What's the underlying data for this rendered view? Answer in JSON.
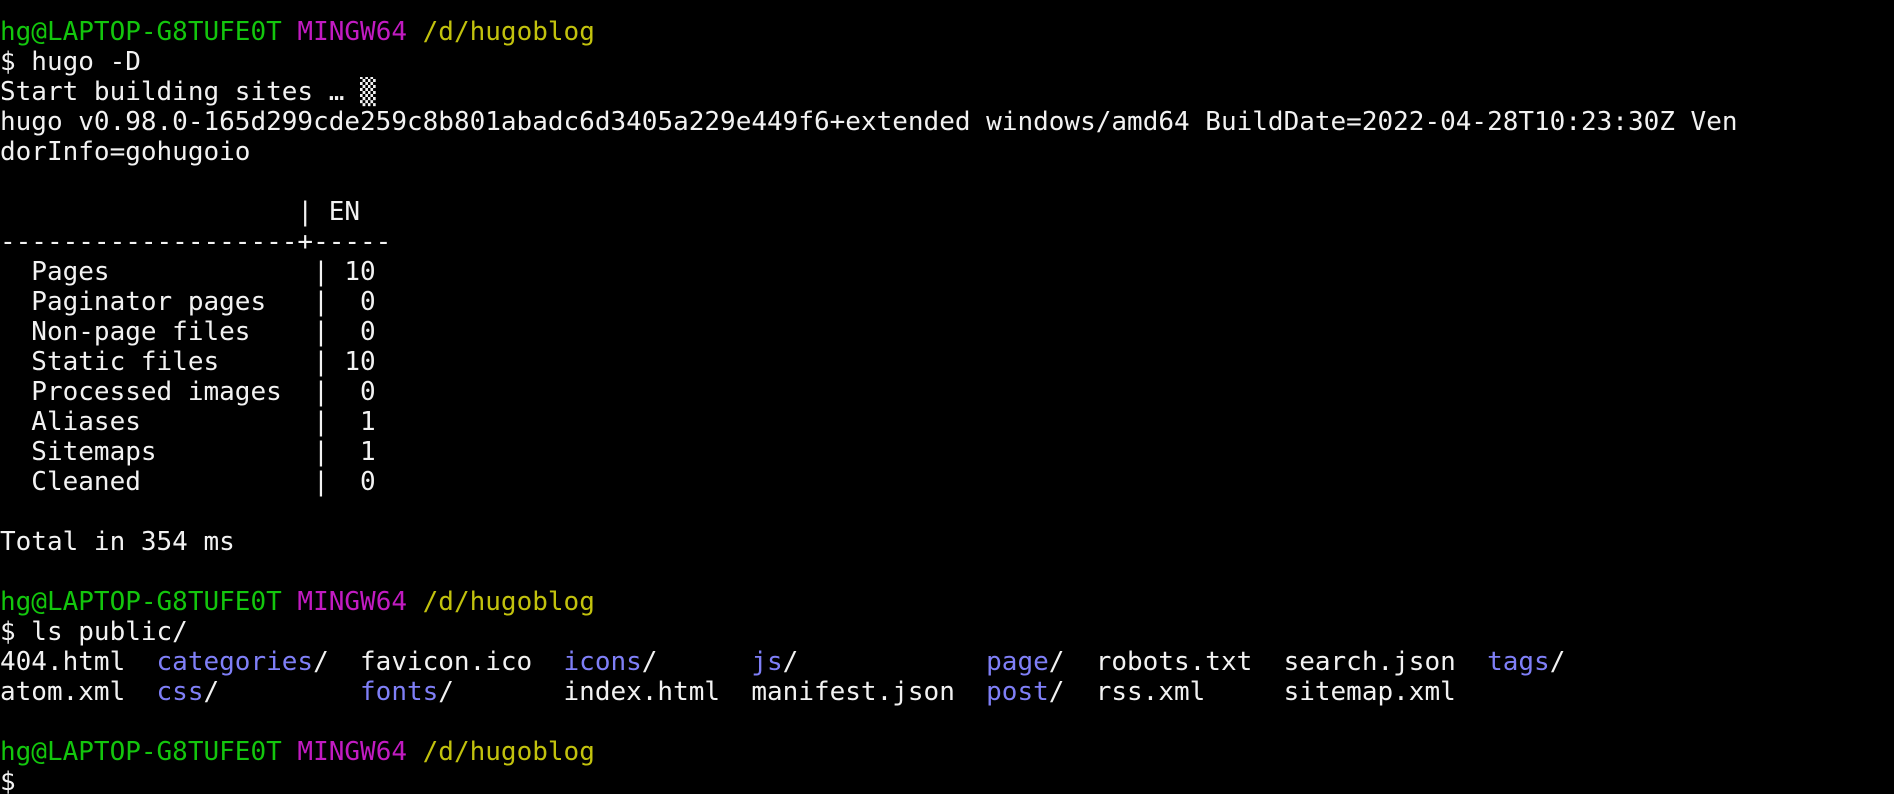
{
  "colors": {
    "background": "#000000",
    "text": "#f2f2f2",
    "user": "#13c60d",
    "env": "#c21bc2",
    "path": "#c2c20d",
    "directory": "#7f7ff7"
  },
  "prompts": [
    {
      "user": "hg@LAPTOP-G8TUFE0T",
      "env": "MINGW64",
      "path": "/d/hugoblog",
      "command": "$ hugo -D"
    },
    {
      "user": "hg@LAPTOP-G8TUFE0T",
      "env": "MINGW64",
      "path": "/d/hugoblog",
      "command": "$ ls public/"
    },
    {
      "user": "hg@LAPTOP-G8TUFE0T",
      "env": "MINGW64",
      "path": "/d/hugoblog",
      "command": "$"
    }
  ],
  "build": {
    "start": "Start building sites … ",
    "version_line_1": "hugo v0.98.0-165d299cde259c8b801abadc6d3405a229e449f6+extended windows/amd64 BuildDate=2022-04-28T10:23:30Z Ven",
    "version_line_2": "dorInfo=gohugoio",
    "table_header": "                   | EN",
    "table_divider": "-------------------+-----",
    "stats": [
      "  Pages             | 10",
      "  Paginator pages   |  0",
      "  Non-page files    |  0",
      "  Static files      | 10",
      "  Processed images  |  0",
      "  Aliases           |  1",
      "  Sitemaps          |  1",
      "  Cleaned           |  0"
    ],
    "total": "Total in 354 ms"
  },
  "listing": {
    "row1": [
      {
        "name": "404.html",
        "suffix": "",
        "is_dir": false
      },
      {
        "name": "categories",
        "suffix": "/",
        "is_dir": true
      },
      {
        "name": "favicon.ico",
        "suffix": "",
        "is_dir": false
      },
      {
        "name": "icons",
        "suffix": "/",
        "is_dir": true
      },
      {
        "name": "js",
        "suffix": "/",
        "is_dir": true
      },
      {
        "name": "page",
        "suffix": "/",
        "is_dir": true
      },
      {
        "name": "robots.txt",
        "suffix": "",
        "is_dir": false
      },
      {
        "name": "search.json",
        "suffix": "",
        "is_dir": false
      },
      {
        "name": "tags",
        "suffix": "/",
        "is_dir": true
      }
    ],
    "row2": [
      {
        "name": "atom.xml",
        "suffix": "",
        "is_dir": false
      },
      {
        "name": "css",
        "suffix": "/",
        "is_dir": true
      },
      {
        "name": "fonts",
        "suffix": "/",
        "is_dir": true
      },
      {
        "name": "index.html",
        "suffix": "",
        "is_dir": false
      },
      {
        "name": "manifest.json",
        "suffix": "",
        "is_dir": false
      },
      {
        "name": "post",
        "suffix": "/",
        "is_dir": true
      },
      {
        "name": "rss.xml",
        "suffix": "",
        "is_dir": false
      },
      {
        "name": "sitemap.xml",
        "suffix": "",
        "is_dir": false
      }
    ]
  }
}
